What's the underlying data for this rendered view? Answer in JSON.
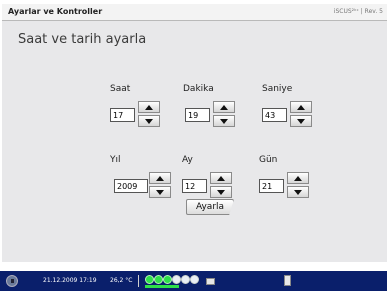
{
  "window": {
    "title": "Ayarlar ve Kontroller",
    "brand": "iSCUS²ᵏᶜ | Rev. 5"
  },
  "page": {
    "title": "Saat ve tarih ayarla"
  },
  "fields": {
    "hour": {
      "label": "Saat",
      "value": "17"
    },
    "minute": {
      "label": "Dakika",
      "value": "19"
    },
    "second": {
      "label": "Saniye",
      "value": "43"
    },
    "year": {
      "label": "Yıl",
      "value": "2009"
    },
    "month": {
      "label": "Ay",
      "value": "12"
    },
    "day": {
      "label": "Gün",
      "value": "21"
    }
  },
  "actions": {
    "apply_label": "Ayarla"
  },
  "statusbar": {
    "datetime": "21.12.2009 17:19",
    "temperature": "26,2 °C"
  },
  "icons": {
    "power": "power-icon",
    "up": "triangle-up-icon",
    "down": "triangle-down-icon",
    "info": "info-icon"
  },
  "colors": {
    "taskbar": "#0a1f6b",
    "panel": "#e8e8ea",
    "led_on": "#2ee04a"
  }
}
